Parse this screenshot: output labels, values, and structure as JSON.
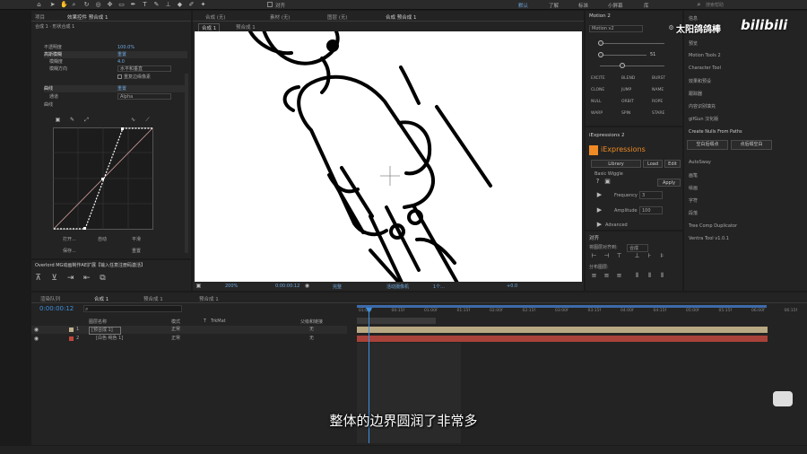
{
  "menubar": {
    "items": [
      "对齐"
    ],
    "right": [
      "默认",
      "了解",
      "标准",
      "小屏幕",
      "库"
    ],
    "search_placeholder": "搜索帮助"
  },
  "project_panel": {
    "tabs": [
      "项目",
      "效果控件 预合成 1"
    ],
    "breadcrumb": "合成 1 · 形状合成 1",
    "rows": [
      {
        "label": "不透明度",
        "value": "100.0%"
      },
      {
        "label": "高斯模糊",
        "value": "重置"
      },
      {
        "label": "模糊度",
        "value": "4.0"
      },
      {
        "label": "模糊方向",
        "value": "水平和垂直"
      },
      {
        "label": "",
        "value": "重复边缘像素"
      },
      {
        "label": "曲线",
        "value": "重置"
      },
      {
        "label": "通道",
        "value": "Alpha"
      },
      {
        "label": "曲线",
        "value": ""
      }
    ],
    "curve_buttons": [
      "打开...",
      "自动",
      "平滑",
      "保存...",
      "重置"
    ]
  },
  "plugin_tab": "Overlord MG动画制作AE扩展【输入任意注册码激活】",
  "comp_viewer": {
    "tabs": [
      "合成 预合成 1",
      "合成 1",
      "预合成 1"
    ],
    "top_tabs": [
      "合成 (无)",
      "素材 (无)",
      "图层 (无)"
    ],
    "zoom": "200%",
    "timecode": "0:00:00:12",
    "quality": "完整",
    "camera": "活动摄像机",
    "views": "1个...",
    "offset": "+0.0"
  },
  "motion_panel": {
    "title": "Motion 2",
    "version": "Motion v2",
    "slider_value": "51",
    "buttons": [
      "EXCITE",
      "BLEND",
      "BURST",
      "CLONE",
      "JUMP",
      "NAME",
      "NULL",
      "ORBIT",
      "ROPE",
      "WARP",
      "SPIN",
      "STARE"
    ]
  },
  "expressions_panel": {
    "title": "iExpressions 2",
    "logo": "iExpressions",
    "tabs": [
      "Library",
      "Load",
      "Edit"
    ],
    "item": "Basic Wiggle",
    "apply": "Apply",
    "fields": [
      {
        "label": "Frequency",
        "value": "3"
      },
      {
        "label": "Amplitude",
        "value": "100"
      }
    ],
    "advanced": "Advanced"
  },
  "align_panel": {
    "title": "对齐",
    "label": "将图层对齐到:",
    "target": "合成",
    "distribute": "分布图层:"
  },
  "right_sidebar": {
    "items": [
      "信息",
      "预览",
      "Motion Tools 2",
      "Character Tool",
      "效果和预设",
      "跟踪器",
      "内容识别填充",
      "gifGun 汉化版",
      "Create Nulls From Paths",
      "空白后缀点",
      "点后缀空白",
      "AutoSway",
      "画笔",
      "绘画",
      "字符",
      "段落",
      "Tree Comp Duplicator",
      "Ventra Tool v1.0.1"
    ]
  },
  "timeline": {
    "tabs": [
      "渲染队列",
      "合成 1",
      "预合成 1",
      "预合成 1"
    ],
    "timecode": "0:00:00:12",
    "search_placeholder": "",
    "columns": [
      "图层名称",
      "模式",
      "T",
      "TrkMat",
      "父级和链接"
    ],
    "layers": [
      {
        "num": "1",
        "name": "[预合成 1]",
        "mode": "正常",
        "parent": "无",
        "color": "#c2b28e"
      },
      {
        "num": "2",
        "name": "[白色 纯色 1]",
        "mode": "正常",
        "parent": "无",
        "color": "#c0463c"
      }
    ],
    "ruler": [
      "01:00f",
      "00:15f",
      "01:00f",
      "01:15f",
      "02:00f",
      "02:15f",
      "03:00f",
      "03:15f",
      "04:00f",
      "04:15f",
      "05:00f",
      "05:15f",
      "06:00f",
      "06:15f"
    ],
    "track_colors": [
      "#b9a983",
      "#a8423a"
    ]
  },
  "watermark": {
    "author": "太阳鸽鸽棒",
    "site": "bilibili"
  },
  "subtitle": "整体的边界圆润了非常多"
}
